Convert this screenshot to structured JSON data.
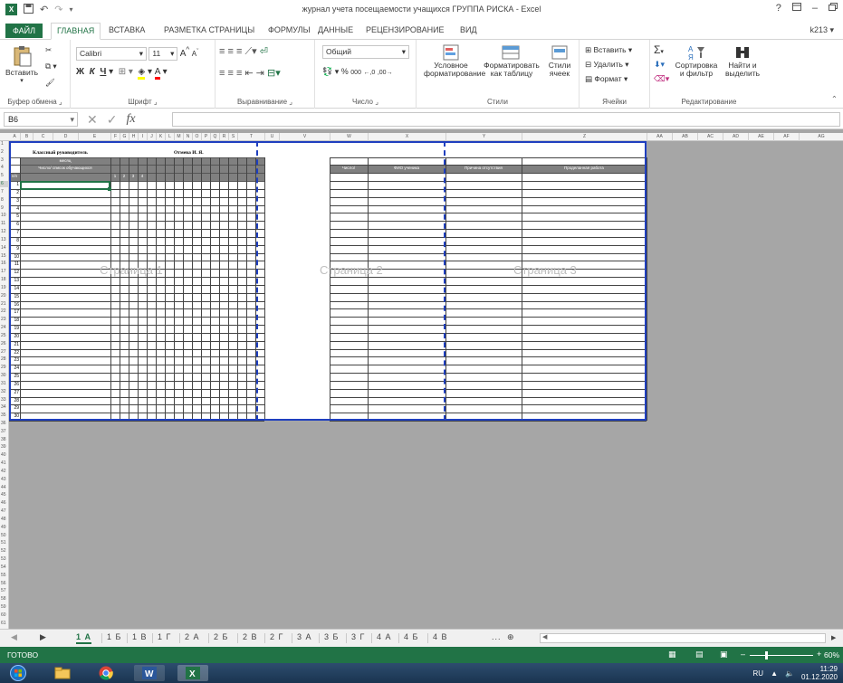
{
  "titlebar": {
    "title": "журнал учета посещаемости учащихся ГРУППА РИСКА - Excel",
    "help": "?",
    "min": "–"
  },
  "tabs": {
    "file": "ФАЙЛ",
    "items": [
      "ГЛАВНАЯ",
      "ВСТАВКА",
      "РАЗМЕТКА СТРАНИЦЫ",
      "ФОРМУЛЫ",
      "ДАННЫЕ",
      "РЕЦЕНЗИРОВАНИЕ",
      "ВИД"
    ],
    "user": "k213"
  },
  "ribbon": {
    "clipboard": {
      "paste": "Вставить",
      "label": "Буфер обмена"
    },
    "font": {
      "name": "Calibri",
      "size": "11",
      "label": "Шрифт",
      "bold": "Ж",
      "italic": "К",
      "underline": "Ч"
    },
    "alignment": {
      "label": "Выравнивание"
    },
    "number": {
      "format": "Общий",
      "label": "Число",
      "percent": "%",
      "thousands": "000"
    },
    "styles": {
      "conditional": "Условное форматирование",
      "as_table": "Форматировать как таблицу",
      "cell_styles": "Стили ячеек",
      "label": "Стили"
    },
    "cells": {
      "insert": "Вставить",
      "delete": "Удалить",
      "format": "Формат",
      "label": "Ячейки"
    },
    "editing": {
      "sort": "Сортировка и фильтр",
      "find": "Найти и выделить",
      "label": "Редактирование"
    }
  },
  "formula_bar": {
    "name_box": "B6",
    "fx": "fx"
  },
  "columns": [
    "A",
    "B",
    "C",
    "D",
    "E",
    "F",
    "G",
    "H",
    "I",
    "J",
    "K",
    "L",
    "M",
    "N",
    "O",
    "P",
    "Q",
    "R",
    "S",
    "T",
    "U",
    "V",
    "W",
    "X",
    "Y",
    "Z",
    "AA",
    "AB",
    "AC",
    "AD",
    "AE",
    "AF",
    "AG"
  ],
  "sheet_content": {
    "class_teacher_label": "Классный руководитель",
    "teacher_name": "Отмева И. Я.",
    "month_header": "месяц",
    "student_list_header": "Число/ список обучающихся",
    "col_nums": [
      "1",
      "2",
      "3",
      "4"
    ],
    "pn_header": "п/п",
    "page2_headers": [
      "Число/",
      "ФИО ученика",
      "Причина отсутствия",
      "Проделанная работа"
    ],
    "watermarks": [
      "Страница 1",
      "Страница 2",
      "Страница 3"
    ]
  },
  "sheet_tabs": {
    "items": [
      "1 А",
      "1 Б",
      "1 В",
      "1 Г",
      "2 А",
      "2 Б",
      "2 В",
      "2 Г",
      "3 А",
      "3 Б",
      "3 Г",
      "4 А",
      "4 Б",
      "4 В"
    ],
    "active": "1 А",
    "more": "...",
    "add": "⊕"
  },
  "status": {
    "text": "ГОТОВО",
    "zoom": "60%"
  },
  "taskbar": {
    "lang": "RU",
    "time": "11:29",
    "date": "01.12.2020"
  }
}
